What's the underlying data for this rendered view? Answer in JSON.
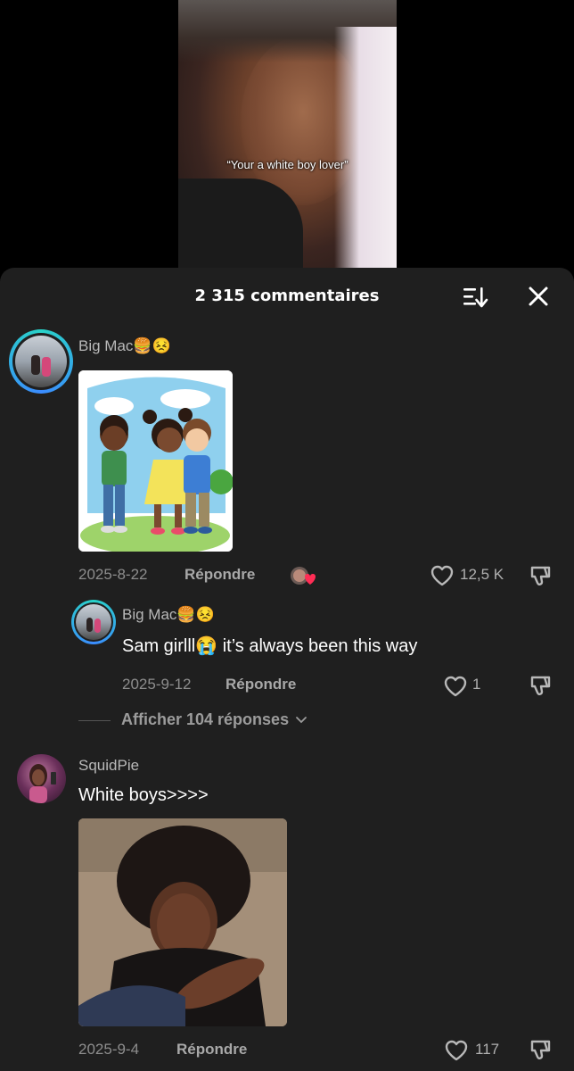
{
  "video": {
    "caption": "“Your a white boy lover”"
  },
  "panel": {
    "title": "2 315 commentaires",
    "sort_icon": "sort-icon",
    "close_icon": "close-icon"
  },
  "comments": [
    {
      "username": "Big Mac",
      "username_emojis": "🍔😣",
      "image": "cartoon-children-hugging",
      "date": "2025-8-22",
      "reply_label": "Répondre",
      "creator_liked_icon": "creator-liked-heart-icon",
      "likes": "12,5 K",
      "replies": [
        {
          "username": "Big Mac",
          "username_emojis": "🍔😣",
          "text_before": "Sam girlll",
          "text_emoji": "😭",
          "text_after": " it’s always been this way",
          "date": "2025-9-12",
          "reply_label": "Répondre",
          "likes": "1"
        }
      ],
      "more_replies": "Afficher 104 réponses"
    },
    {
      "username": "SquidPie",
      "text": "White boys>>>>",
      "image": "selfie-photo",
      "date": "2025-9-4",
      "reply_label": "Répondre",
      "likes": "117"
    }
  ],
  "colors": {
    "panel_bg": "#1f1f1f",
    "text_primary": "#ffffff",
    "text_secondary": "#8d8d8d",
    "avatar_ring": "#29d3c8",
    "heart_red": "#ff2d55"
  }
}
